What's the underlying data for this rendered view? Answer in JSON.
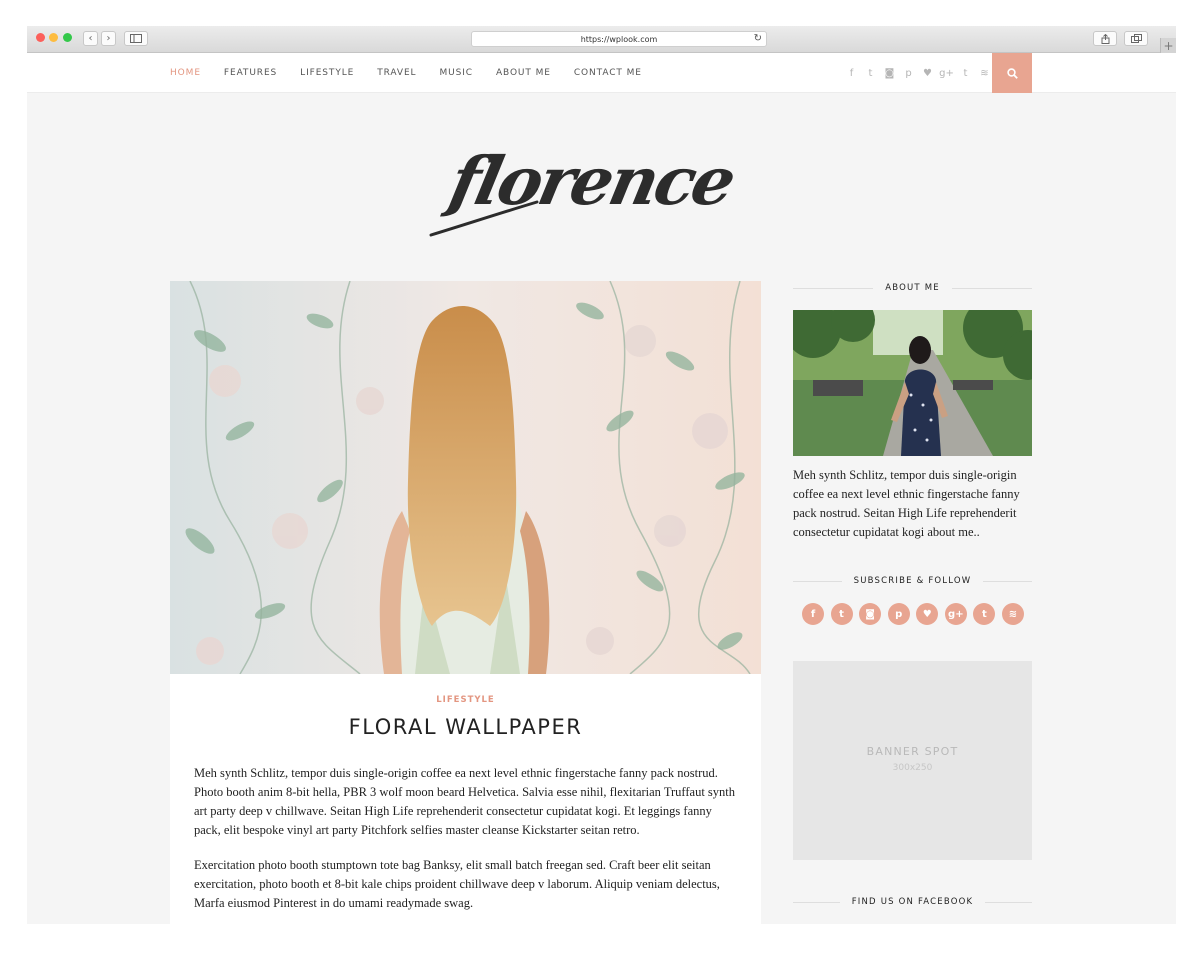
{
  "browser": {
    "url": "https://wplook.com",
    "back_icon": "‹",
    "forward_icon": "›",
    "reload_icon": "↻",
    "new_tab_icon": "+"
  },
  "nav": {
    "items": [
      "HOME",
      "FEATURES",
      "LIFESTYLE",
      "TRAVEL",
      "MUSIC",
      "ABOUT ME",
      "CONTACT ME"
    ],
    "active": "HOME",
    "social": [
      "f",
      "t",
      "◙",
      "p",
      "♥",
      "g+",
      "t",
      "≋"
    ]
  },
  "logo": {
    "text": "florence"
  },
  "post": {
    "category": "LIFESTYLE",
    "title": "FLORAL WALLPAPER",
    "paragraphs": [
      "Meh synth Schlitz, tempor duis single-origin coffee ea next level ethnic fingerstache fanny pack nostrud. Photo booth anim 8-bit hella, PBR 3 wolf moon beard Helvetica. Salvia esse nihil, flexitarian Truffaut synth art party deep v chillwave. Seitan High Life reprehenderit consectetur cupidatat kogi. Et leggings fanny pack, elit bespoke vinyl art party Pitchfork selfies master cleanse Kickstarter seitan retro.",
      "Exercitation photo booth stumptown tote bag Banksy, elit small batch freegan sed. Craft beer elit seitan exercitation, photo booth et 8-bit kale chips proident chillwave deep v laborum. Aliquip veniam delectus, Marfa eiusmod Pinterest in do umami readymade swag."
    ]
  },
  "sidebar": {
    "about_title": "ABOUT ME",
    "about_text": "Meh synth Schlitz, tempor duis single-origin coffee ea next level ethnic fingerstache fanny pack nostrud. Seitan High Life reprehenderit consectetur cupidatat kogi about me..",
    "subscribe_title": "SUBSCRIBE & FOLLOW",
    "social": [
      "f",
      "t",
      "◙",
      "p",
      "♥",
      "g+",
      "t",
      "≋"
    ],
    "banner_label": "BANNER SPOT",
    "banner_size": "300x250",
    "facebook_title": "FIND US ON FACEBOOK"
  },
  "colors": {
    "accent": "#e8a591",
    "accent_text": "#e39681",
    "background": "#f5f5f5"
  }
}
